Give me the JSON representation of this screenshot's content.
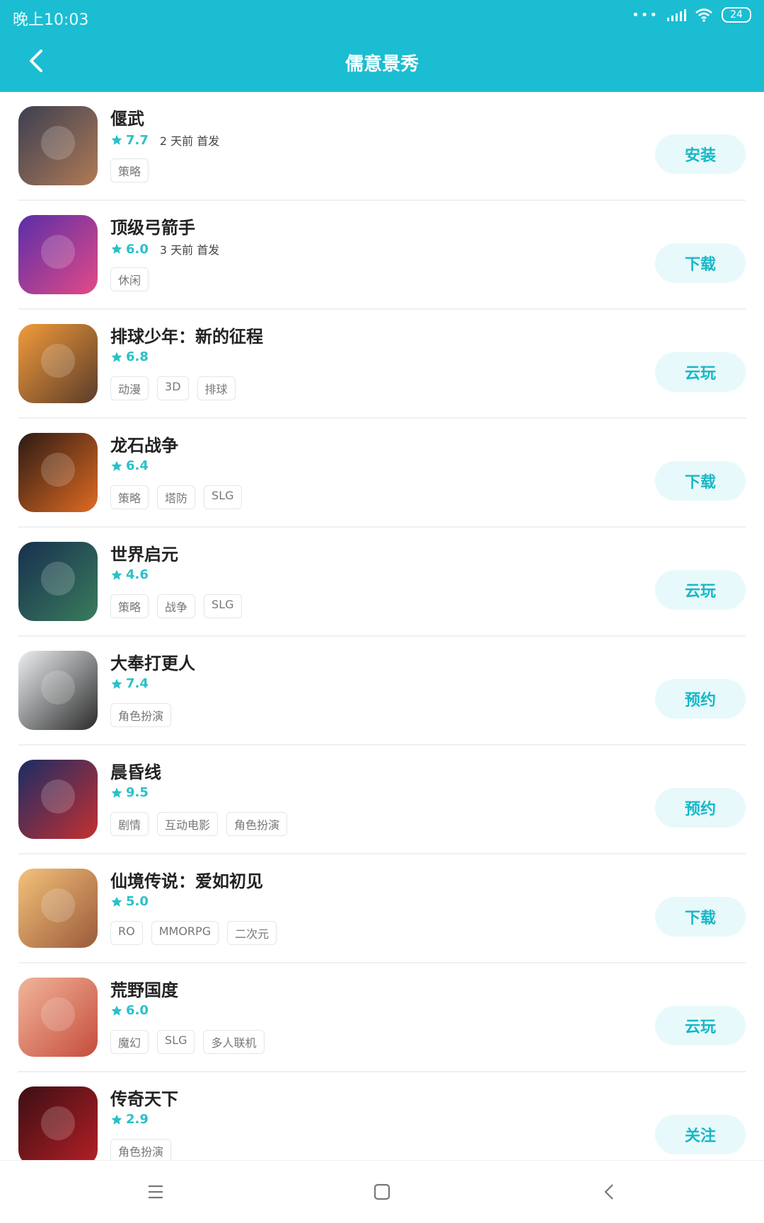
{
  "status_bar": {
    "time": "晚上10:03",
    "dots": "•••",
    "battery": "24"
  },
  "header": {
    "title": "儒意景秀",
    "accent_color": "#1bbdd2"
  },
  "games": [
    {
      "name": "偃武",
      "rating": "7.7",
      "release": "2 天前 首发",
      "tags": [
        "策略"
      ],
      "button": "安装",
      "icon_colors": [
        "#3b3f52",
        "#b07a55"
      ]
    },
    {
      "name": "顶级弓箭手",
      "rating": "6.0",
      "release": "3 天前 首发",
      "tags": [
        "休闲"
      ],
      "button": "下载",
      "icon_colors": [
        "#5a2ea8",
        "#e34a86"
      ]
    },
    {
      "name": "排球少年：新的征程",
      "rating": "6.8",
      "release": "",
      "tags": [
        "动漫",
        "3D",
        "排球"
      ],
      "button": "云玩",
      "icon_colors": [
        "#f39b3a",
        "#5a3c2a"
      ]
    },
    {
      "name": "龙石战争",
      "rating": "6.4",
      "release": "",
      "tags": [
        "策略",
        "塔防",
        "SLG"
      ],
      "button": "下载",
      "icon_colors": [
        "#2b1a14",
        "#e06b22"
      ]
    },
    {
      "name": "世界启元",
      "rating": "4.6",
      "release": "",
      "tags": [
        "策略",
        "战争",
        "SLG"
      ],
      "button": "云玩",
      "icon_colors": [
        "#17304f",
        "#3a7c5c"
      ]
    },
    {
      "name": "大奉打更人",
      "rating": "7.4",
      "release": "",
      "tags": [
        "角色扮演"
      ],
      "button": "预约",
      "icon_colors": [
        "#eceff1",
        "#2b2b2b"
      ]
    },
    {
      "name": "晨昏线",
      "rating": "9.5",
      "release": "",
      "tags": [
        "剧情",
        "互动电影",
        "角色扮演"
      ],
      "button": "预约",
      "icon_colors": [
        "#1a2c66",
        "#c43030"
      ]
    },
    {
      "name": "仙境传说：爱如初见",
      "rating": "5.0",
      "release": "",
      "tags": [
        "RO",
        "MMORPG",
        "二次元"
      ],
      "button": "下载",
      "icon_colors": [
        "#f4c27a",
        "#9a5a3a"
      ]
    },
    {
      "name": "荒野国度",
      "rating": "6.0",
      "release": "",
      "tags": [
        "魔幻",
        "SLG",
        "多人联机"
      ],
      "button": "云玩",
      "icon_colors": [
        "#f1b69b",
        "#c64c3c"
      ]
    },
    {
      "name": "传奇天下",
      "rating": "2.9",
      "release": "",
      "tags": [
        "角色扮演"
      ],
      "button": "关注",
      "icon_colors": [
        "#3a0f14",
        "#b51f26"
      ]
    }
  ]
}
